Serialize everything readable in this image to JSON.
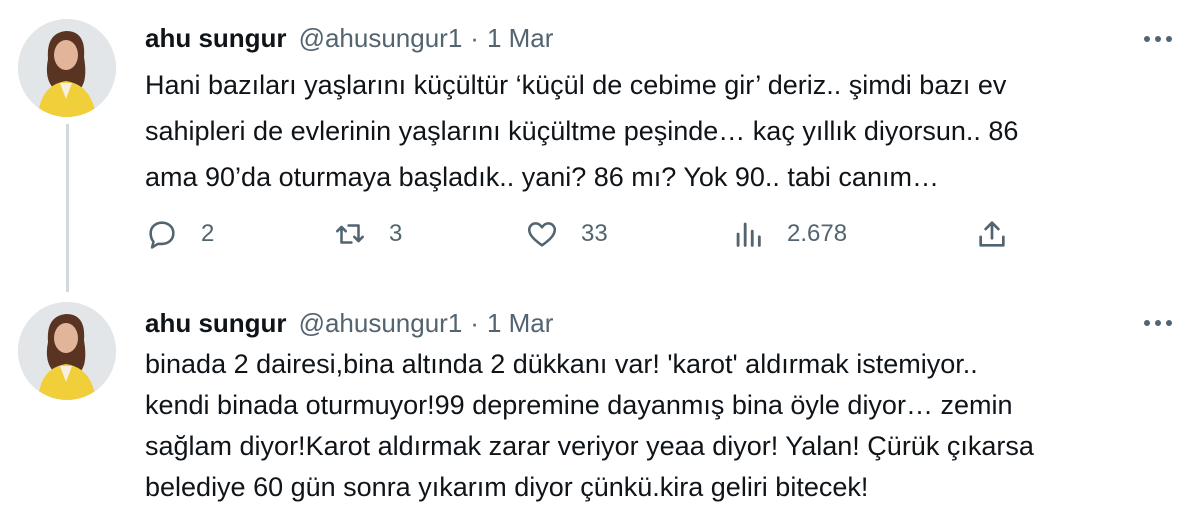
{
  "tweets": [
    {
      "author_name": "ahu sungur",
      "handle": "@ahusungur1",
      "separator": "·",
      "date": "1 Mar",
      "text_lines": [
        "Hani bazıları yaşlarını küçültür ‘küçül de cebime gir’ deriz.. şimdi bazı ev",
        "sahipleri de evlerinin yaşlarını küçültme peşinde… kaç yıllık diyorsun.. 86",
        "ama 90’da oturmaya başladık.. yani? 86 mı? Yok 90.. tabi canım…"
      ],
      "replies": "2",
      "retweets": "3",
      "likes": "33",
      "views": "2.678"
    },
    {
      "author_name": "ahu sungur",
      "handle": "@ahusungur1",
      "separator": "·",
      "date": "1 Mar",
      "text_lines": [
        "binada 2 dairesi,bina altında 2 dükkanı var! 'karot' aldırmak istemiyor..",
        "kendi binada oturmuyor!99 depremine dayanmış bina öyle diyor… zemin",
        "sağlam diyor!Karot aldırmak zarar veriyor yeaa diyor! Yalan! Çürük çıkarsa",
        "belediye 60 gün sonra yıkarım diyor çünkü.kira geliri bitecek!"
      ]
    }
  ],
  "icons": {
    "reply": "reply-icon",
    "retweet": "retweet-icon",
    "like": "heart-icon",
    "views": "views-icon",
    "share": "share-icon",
    "more": "more-icon"
  },
  "colors": {
    "text": "#0f1419",
    "secondary": "#536471",
    "thread_line": "#cfd9de",
    "avatar_jacket": "#f1cf3a"
  }
}
